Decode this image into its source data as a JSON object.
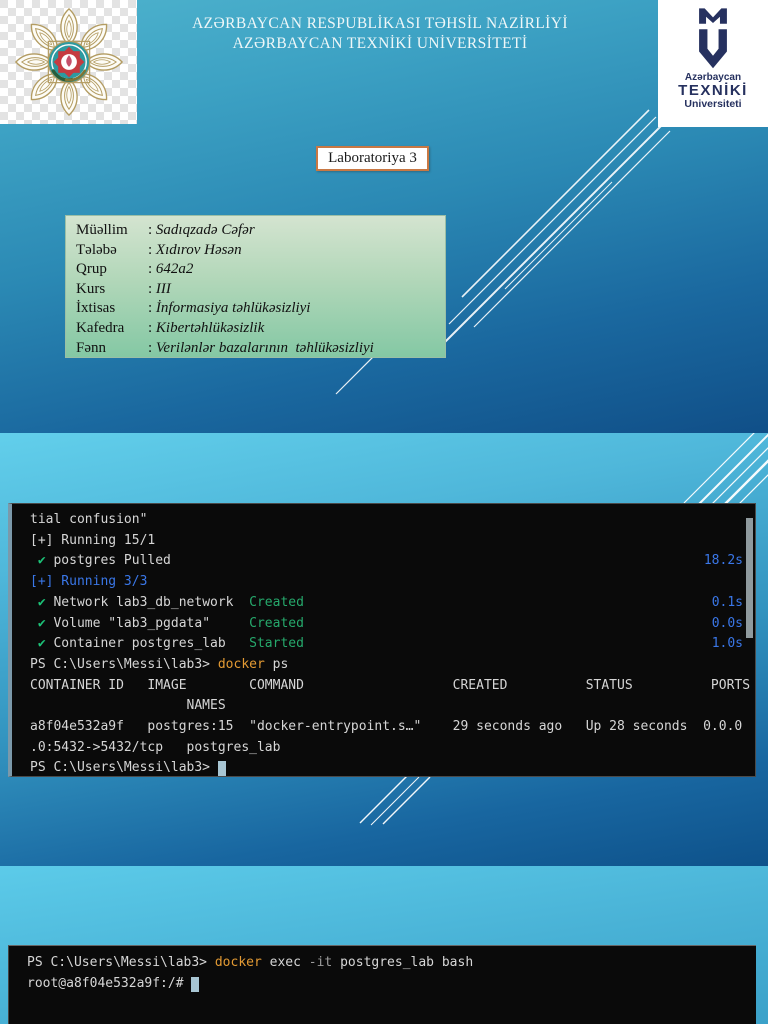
{
  "colors": {
    "slide_gradient_top": "#5ecde9",
    "slide_gradient_bottom": "#0f538c",
    "terminal_background": "#0a0a0a",
    "terminal_text": "#d6d6d6",
    "terminal_green": "#26a96c",
    "terminal_check_green": "#1cc177",
    "terminal_blue": "#3a77e8",
    "terminal_command_orange": "#e39a33",
    "terminal_param_gray": "#9b9b9b",
    "title_box_border": "#c87844",
    "logo_navy": "#26315f",
    "emblem_gold": "#b39c62",
    "emblem_teal": "#2d9aa0",
    "emblem_red": "#c53b40",
    "info_box_green_top": "#d4e4d0",
    "info_box_green_bottom": "#84c8a4"
  },
  "slide1": {
    "header_line1": "AZƏRBAYCAN RESPUBLİKASI TƏHSİL NAZİRLİYİ",
    "header_line2": "AZƏRBAYCAN TEXNİKİ UNİVERSİTETİ",
    "title_box": "Laboratoriya 3",
    "logo": {
      "country": "Azərbaycan",
      "name": "TEXNİKİ",
      "suffix": "Universiteti"
    },
    "info_rows": [
      {
        "label": "Müəllim",
        "value": "Sadıqzadə Cəfər"
      },
      {
        "label": "Tələbə",
        "value": "Xıdırov Həsən"
      },
      {
        "label": "Qrup",
        "value": "642a2"
      },
      {
        "label": "Kurs",
        "value": "III"
      },
      {
        "label": "İxtisas",
        "value": "İnformasiya təhlükəsizliyi"
      },
      {
        "label": "Kafedra",
        "value": "Kibertəhlükəsizlik"
      },
      {
        "label": "Fənn",
        "value": "Verilənlər bazalarının  təhlükəsizliyi"
      }
    ]
  },
  "terminal1": {
    "lines": [
      [
        {
          "t": "tial confusion\"",
          "c": "w"
        }
      ],
      [
        {
          "t": "[+] Running 15/1",
          "c": "w"
        }
      ],
      [
        {
          "t": " ",
          "c": "w"
        },
        {
          "t": "✔",
          "c": "gb"
        },
        {
          "t": " postgres Pulled",
          "c": "w"
        },
        {
          "t": "18.2s",
          "c": "b",
          "right": true
        }
      ],
      [
        {
          "t": "[+] Running 3/3",
          "c": "b"
        }
      ],
      [
        {
          "t": " ",
          "c": "w"
        },
        {
          "t": "✔",
          "c": "gb"
        },
        {
          "t": " Network lab3_db_network  ",
          "c": "w"
        },
        {
          "t": "Created",
          "c": "g"
        },
        {
          "t": "0.1s",
          "c": "b",
          "right": true
        }
      ],
      [
        {
          "t": " ",
          "c": "w"
        },
        {
          "t": "✔",
          "c": "gb"
        },
        {
          "t": " Volume \"lab3_pgdata\"     ",
          "c": "w"
        },
        {
          "t": "Created",
          "c": "g"
        },
        {
          "t": "0.0s",
          "c": "b",
          "right": true
        }
      ],
      [
        {
          "t": " ",
          "c": "w"
        },
        {
          "t": "✔",
          "c": "gb"
        },
        {
          "t": " Container postgres_lab   ",
          "c": "w"
        },
        {
          "t": "Started",
          "c": "g"
        },
        {
          "t": "1.0s",
          "c": "b",
          "right": true
        }
      ],
      [
        {
          "t": "PS C:\\Users\\Messi\\lab3> ",
          "c": "w"
        },
        {
          "t": "docker",
          "c": "o"
        },
        {
          "t": " ps",
          "c": "w"
        }
      ],
      [
        {
          "t": "CONTAINER ID   IMAGE        COMMAND                   CREATED          STATUS          PORTS",
          "c": "w"
        }
      ],
      [
        {
          "t": "                    NAMES",
          "c": "w"
        }
      ],
      [
        {
          "t": "a8f04e532a9f   postgres:15  \"docker-entrypoint.s…\"    29 seconds ago   Up 28 seconds  0.0.0",
          "c": "w"
        }
      ],
      [
        {
          "t": ".0:5432->5432/tcp   postgres_lab",
          "c": "w"
        }
      ],
      [
        {
          "t": "PS C:\\Users\\Messi\\lab3> ",
          "c": "w"
        },
        {
          "cursor": true
        }
      ]
    ]
  },
  "terminal2": {
    "lines": [
      [
        {
          "t": "PS C:\\Users\\Messi\\lab3> ",
          "c": "w"
        },
        {
          "t": "docker",
          "c": "o"
        },
        {
          "t": " exec ",
          "c": "w"
        },
        {
          "t": "-it",
          "c": "gy"
        },
        {
          "t": " postgres_lab bash",
          "c": "w"
        }
      ],
      [
        {
          "t": "root@a8f04e532a9f:/# ",
          "c": "w"
        },
        {
          "cursor": true
        }
      ]
    ]
  }
}
